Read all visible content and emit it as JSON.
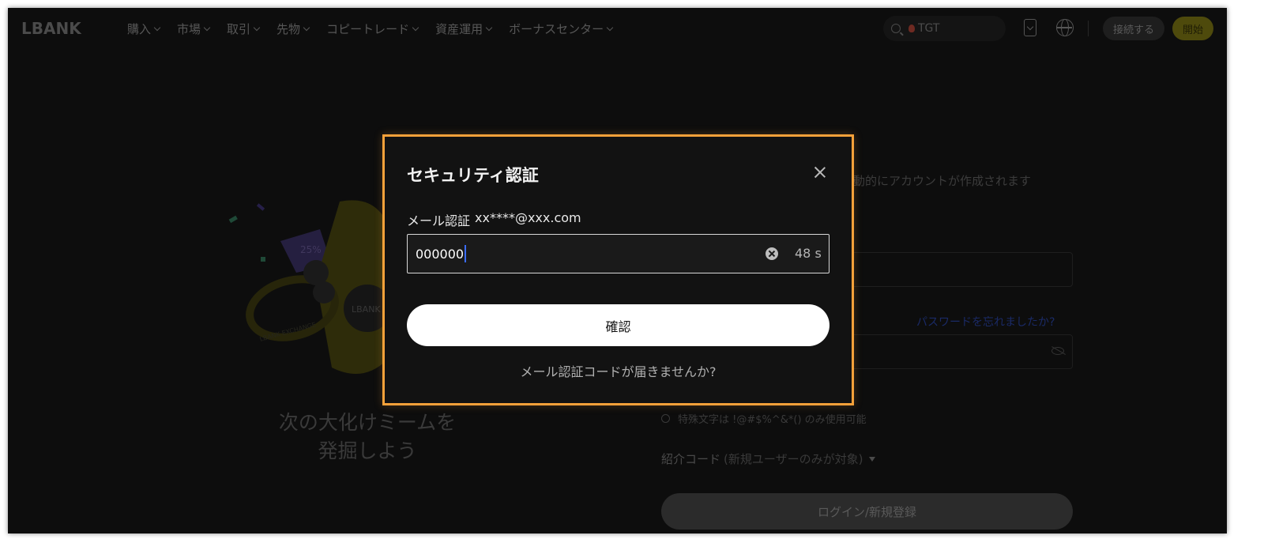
{
  "header": {
    "logo": "LBANK",
    "nav": [
      {
        "label": "購入"
      },
      {
        "label": "市場"
      },
      {
        "label": "取引"
      },
      {
        "label": "先物"
      },
      {
        "label": "コピートレード"
      },
      {
        "label": "資産運用"
      },
      {
        "label": "ボーナスセンター"
      }
    ],
    "search": {
      "value": "TGT",
      "icon": "search-icon"
    },
    "connect_label": "接続する",
    "start_label": "開始"
  },
  "hero": {
    "slogan_line1": "次の大化けミームを",
    "slogan_line2": "発掘しよう",
    "illustration_text": {
      "ring": "LBANK EXCHANGE",
      "badge": "25%",
      "coin": "LBANK"
    }
  },
  "login_form": {
    "subtitle": "動的にアカウントが作成されます",
    "forgot_password": "パスワードを忘れましたか?",
    "password_rule": "特殊文字は !@#$%^&*() のみ使用可能",
    "referral_label": "紹介コード",
    "referral_note": "(新規ユーザーのみが対象)",
    "submit_label": "ログイン/新規登録"
  },
  "modal": {
    "title": "セキュリティ認証",
    "email_label": "メール認証",
    "email_masked": "xx****@xxx.com",
    "code_value": "000000",
    "countdown": "48 s",
    "confirm_label": "確認",
    "resend_text": "メール認証コードが届きませんか?"
  },
  "colors": {
    "modal_border": "#f5a13a",
    "modal_bg": "#121212",
    "page_bg": "#0d0d0d",
    "confirm_bg": "#ffffff",
    "accent_yellow": "#e6dc18"
  }
}
